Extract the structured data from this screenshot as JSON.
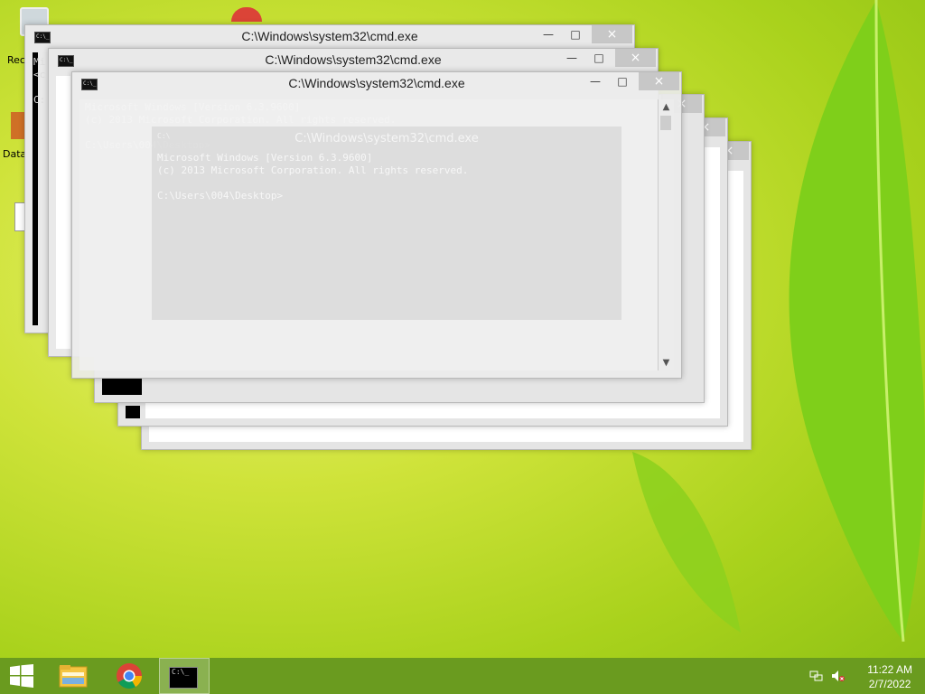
{
  "desktop": {
    "fragments": [
      "Rec",
      "Mi",
      "<c",
      "C:",
      "Data"
    ]
  },
  "windows": [
    {
      "title": "C:\\Windows\\system32\\cmd.exe",
      "close": "×",
      "min": "—",
      "max": "□"
    },
    {
      "title": "C:\\Windows\\system32\\cmd.exe",
      "close": "×",
      "min": "—",
      "max": "□"
    },
    {
      "title": "C:\\Windows\\system32\\cmd.exe",
      "close": "×",
      "min": "—",
      "max": "□"
    },
    {
      "title": "C:\\Windows\\system32\\cmd.exe",
      "close": "×",
      "min": "—",
      "max": "□"
    }
  ],
  "ghost_console": {
    "line1": "Microsoft Windows [Version 6.3.9600]",
    "line2": "(c) 2013 Microsoft Corporation. All rights reserved.",
    "prompt": "C:\\Users\\004\\Desktop>",
    "icon_label": "C:\\",
    "ghost_title": "C:\\Windows\\system32\\cmd.exe"
  },
  "taskbar": {
    "pinned": [
      "start-button",
      "file-explorer",
      "google-chrome",
      "command-prompt"
    ],
    "time": "11:22 AM",
    "date": "2/7/2022"
  },
  "colors": {
    "taskbar": "#6a9b1f",
    "desktop": "#b5d82a"
  }
}
